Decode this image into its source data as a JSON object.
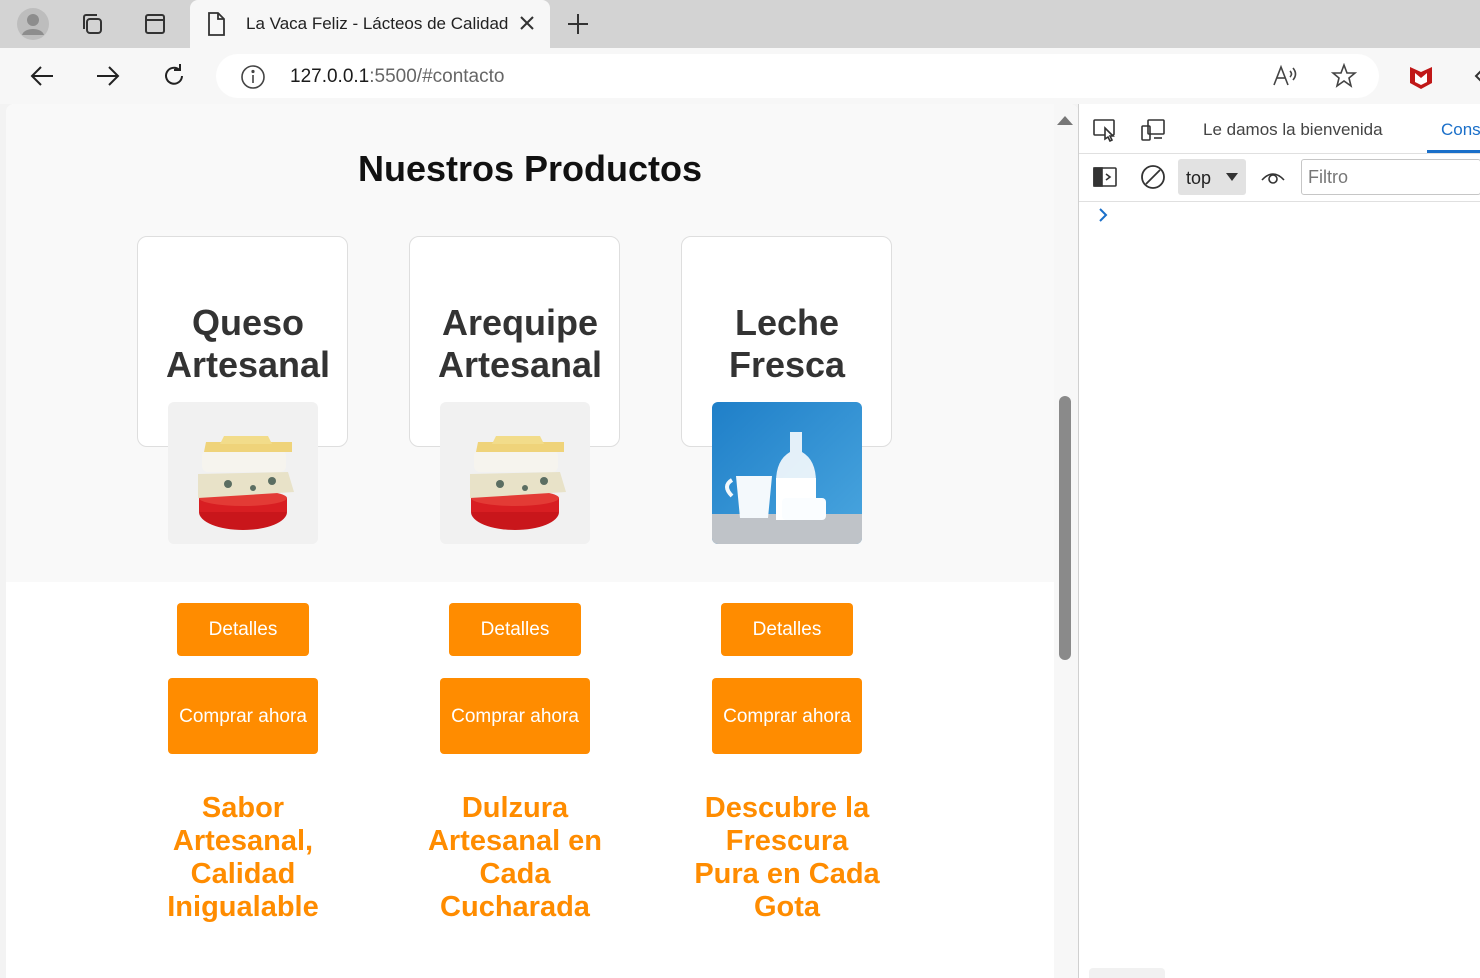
{
  "browser": {
    "tab": {
      "title": "La Vaca Feliz - Lácteos de Calidad"
    },
    "url": {
      "host": "127.0.0.1",
      "rest": ":5500/#contacto"
    }
  },
  "page": {
    "section_title": "Nuestros Productos",
    "accent_color": "#ff8c00",
    "products": [
      {
        "name": "Queso Artesanal",
        "image": "cheese-stack-image",
        "details_label": "Detalles",
        "buy_label": "Comprar ahora",
        "slogan": "Sabor Artesanal, Calidad Inigualable"
      },
      {
        "name": "Arequipe Artesanal",
        "image": "cheese-stack-image",
        "details_label": "Detalles",
        "buy_label": "Comprar ahora",
        "slogan": "Dulzura Artesanal en Cada Cucharada"
      },
      {
        "name": "Leche Fresca",
        "image": "milk-bottles-image",
        "details_label": "Detalles",
        "buy_label": "Comprar ahora",
        "slogan": "Descubre la Frescura Pura en Cada Gota"
      }
    ]
  },
  "devtools": {
    "welcome_tab": "Le damos la bienvenida",
    "console_tab": "Cons",
    "context": "top",
    "filter_placeholder": "Filtro"
  }
}
